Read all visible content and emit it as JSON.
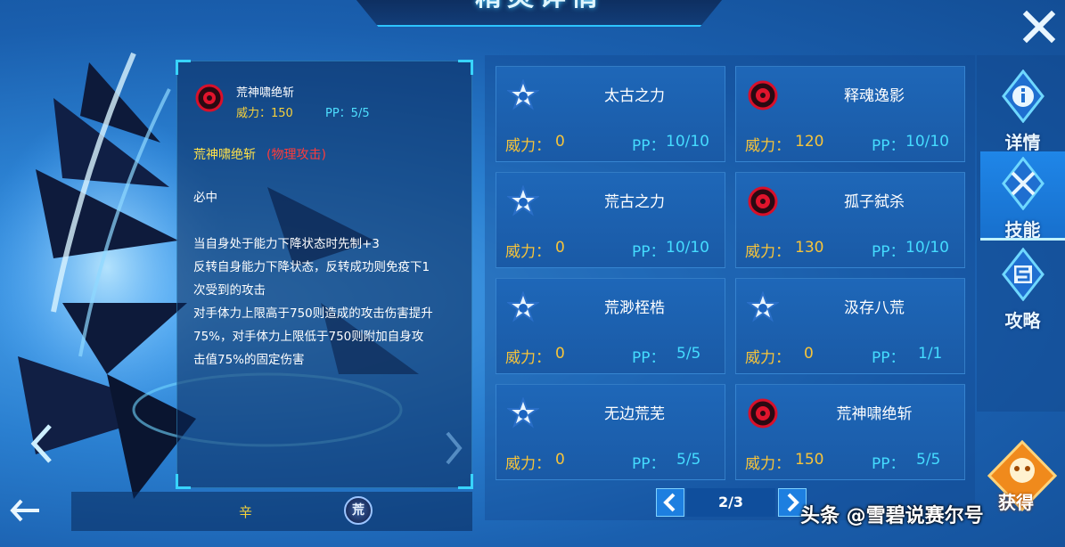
{
  "header": {
    "title": "精灵详情"
  },
  "detail": {
    "skill_name": "荒神啸绝斩",
    "power_label": "威力：150",
    "pp_label": "PP：5/5",
    "skill_title": "荒神啸绝斩",
    "skill_type": "(物理攻击)",
    "lines": [
      "必中",
      "当自身处于能力下降状态时先制+3",
      "反转自身能力下降状态，反转成功则免疫下1",
      "次受到的攻击",
      "对手体力上限高于750则造成的攻击伤害提升",
      "75%，对手体力上限低于750则附加自身攻",
      "击值75%的固定伤害"
    ]
  },
  "footer": {
    "attribute": "辛",
    "badge": "荒"
  },
  "skills": [
    {
      "name": "太古之力",
      "power_label": "威力：",
      "power": "0",
      "pp_label": "PP：",
      "pp": "10/10",
      "icon": "star-icon"
    },
    {
      "name": "释魂逸影",
      "power_label": "威力：",
      "power": "120",
      "pp_label": "PP：",
      "pp": "10/10",
      "icon": "red-orb-icon"
    },
    {
      "name": "荒古之力",
      "power_label": "威力：",
      "power": "0",
      "pp_label": "PP：",
      "pp": "10/10",
      "icon": "star-icon"
    },
    {
      "name": "孤子弑杀",
      "power_label": "威力：",
      "power": "130",
      "pp_label": "PP：",
      "pp": "10/10",
      "icon": "red-orb-icon"
    },
    {
      "name": "荒渺桎梏",
      "power_label": "威力：",
      "power": "0",
      "pp_label": "PP：",
      "pp": "5/5",
      "icon": "star-icon"
    },
    {
      "name": "汲存八荒",
      "power_label": "威力：",
      "power": "0",
      "pp_label": "PP：",
      "pp": "1/1",
      "icon": "star-icon"
    },
    {
      "name": "无边荒芜",
      "power_label": "威力：",
      "power": "0",
      "pp_label": "PP：",
      "pp": "5/5",
      "icon": "star-icon"
    },
    {
      "name": "荒神啸绝斩",
      "power_label": "威力：",
      "power": "150",
      "pp_label": "PP：",
      "pp": "5/5",
      "icon": "red-orb-icon"
    }
  ],
  "pager": {
    "text": "2/3"
  },
  "tabs": [
    {
      "label": "详情",
      "icon": "info-icon"
    },
    {
      "label": "技能",
      "icon": "swords-icon"
    },
    {
      "label": "攻略",
      "icon": "guide-icon"
    }
  ],
  "obtain": {
    "label": "获得"
  },
  "watermark": "头条 @雪碧说赛尔号",
  "colors": {
    "power": "#f7c43a",
    "pp": "#45dcff",
    "accent": "#38d4ff"
  }
}
